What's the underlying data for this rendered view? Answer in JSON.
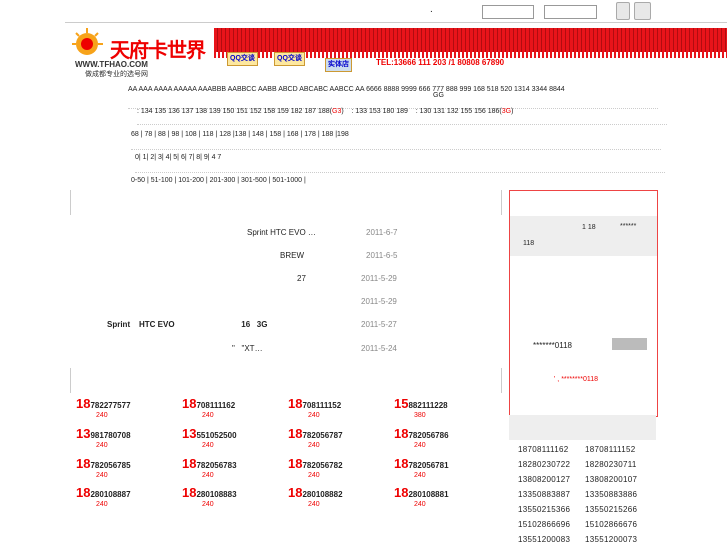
{
  "topbar": {
    "dot": "."
  },
  "logo": {
    "name": "天府卡世界",
    "url": "WWW.TFHAO.COM",
    "slogan": "做成都专业的选号网"
  },
  "header": {
    "qq1": "QQ交谈",
    "qq2": "QQ交谈",
    "shop": "实体店",
    "tel": "TEL:13666 111 203 /1 80808 67890"
  },
  "filters": {
    "patterns": "AA AAA AAAA AAAAA AAABBB AABBCC AABB ABCD ABCABC AABCC  AA 6666 8888 9999 666 777 888 999 168 518 520 1314 3344 8844",
    "pattern_tail": "GG",
    "prefix_a": ": 134 135 136 137 138 139 150 151 152 158 159 182 187 188(",
    "prefix_a_g3": "G3",
    "prefix_a_close": ")",
    "prefix_b": ": 133 153 180 189",
    "prefix_c": ": 130 131 132 155 156 186(",
    "prefix_c_g3": "3G",
    "prefix_c_close": ")",
    "tails": "68  | 78  | 88  | 98 | 108  | 118  | 128  |138  | 148  | 158  | 168  | 178  | 188  |198",
    "digits": "0|   1|   2|   3|   4|   5|   6|   7|   8|   9|   4 7",
    "prices": "0-50  | 51-100  | 101-200  | 201-300 | 301-500  | 501-1000  |"
  },
  "news": [
    {
      "title": "Sprint   HTC EVO          …",
      "date": "2011-6-7"
    },
    {
      "title": "BREW",
      "date": "2011-6-5"
    },
    {
      "title": "27",
      "date": "2011-5-29"
    },
    {
      "title": "",
      "date": "2011-5-29"
    },
    {
      "title": "Sprint    HTC EVO                              16   3G",
      "date": "2011-5-27"
    },
    {
      "title": "\"   \"XT…",
      "date": "2011-5-24"
    }
  ],
  "numbers": [
    {
      "big": "18",
      "rest": "782277577",
      "price": "240"
    },
    {
      "big": "18",
      "rest": "708111162",
      "price": "240"
    },
    {
      "big": "18",
      "rest": "708111152",
      "price": "240"
    },
    {
      "big": "15",
      "rest": "882111228",
      "price": "380"
    },
    {
      "big": "13",
      "rest": "981780708",
      "price": "240"
    },
    {
      "big": "13",
      "rest": "551052500",
      "price": "240"
    },
    {
      "big": "18",
      "rest": "782056787",
      "price": "240"
    },
    {
      "big": "18",
      "rest": "782056786",
      "price": "240"
    },
    {
      "big": "18",
      "rest": "782056785",
      "price": "240"
    },
    {
      "big": "18",
      "rest": "782056783",
      "price": "240"
    },
    {
      "big": "18",
      "rest": "782056782",
      "price": "240"
    },
    {
      "big": "18",
      "rest": "782056781",
      "price": "240"
    },
    {
      "big": "18",
      "rest": "280108887",
      "price": "240"
    },
    {
      "big": "18",
      "rest": "280108883",
      "price": "240"
    },
    {
      "big": "18",
      "rest": "280108882",
      "price": "240"
    },
    {
      "big": "18",
      "rest": "280108881",
      "price": "240"
    }
  ],
  "right_panel": {
    "line1a": "1 18",
    "line1b": "******",
    "line2": "118",
    "masked": "*******0118",
    "note_prefix": "' ,",
    "note_masked": "********0118"
  },
  "right_list": [
    [
      "18708111162",
      "18708111152"
    ],
    [
      "18280230722",
      "18280230711"
    ],
    [
      "13808200127",
      "13808200107"
    ],
    [
      "13350883887",
      "13350883886"
    ],
    [
      "13550215366",
      "13550215266"
    ],
    [
      "15102866696",
      "15102866676"
    ],
    [
      "13551200083",
      "13551200073"
    ]
  ]
}
